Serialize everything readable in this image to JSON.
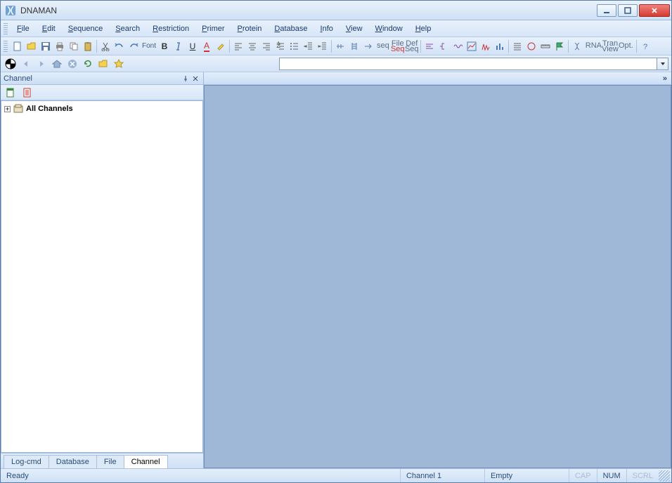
{
  "app": {
    "title": "DNAMAN"
  },
  "menu": {
    "items": [
      {
        "label": "File",
        "u": "F"
      },
      {
        "label": "Edit",
        "u": "E"
      },
      {
        "label": "Sequence",
        "u": "S"
      },
      {
        "label": "Search",
        "u": "S"
      },
      {
        "label": "Restriction",
        "u": "R"
      },
      {
        "label": "Primer",
        "u": "P"
      },
      {
        "label": "Protein",
        "u": "P"
      },
      {
        "label": "Database",
        "u": "D"
      },
      {
        "label": "Info",
        "u": "I"
      },
      {
        "label": "View",
        "u": "V"
      },
      {
        "label": "Window",
        "u": "W"
      },
      {
        "label": "Help",
        "u": "H"
      }
    ]
  },
  "toolbar2": {
    "font_label": "Font",
    "bold": "B",
    "underline": "U",
    "fontcolor": "A",
    "seq": "seq",
    "file_seq_top": "File",
    "file_seq_bot": "Seq",
    "def_seq_top": "Def",
    "def_seq_bot": "Seq",
    "rna": "RNA",
    "tran_top": "Tran",
    "tran_bot": "View",
    "opt": "Opt."
  },
  "address": {
    "value": ""
  },
  "sidepanel": {
    "title": "Channel",
    "tree_root": "All Channels",
    "tabs": [
      "Log-cmd",
      "Database",
      "File",
      "Channel"
    ],
    "active_tab_index": 3
  },
  "content_top_more": "»",
  "status": {
    "ready": "Ready",
    "channel": "Channel 1",
    "empty": "Empty",
    "cap": "CAP",
    "num": "NUM",
    "scrl": "SCRL"
  }
}
